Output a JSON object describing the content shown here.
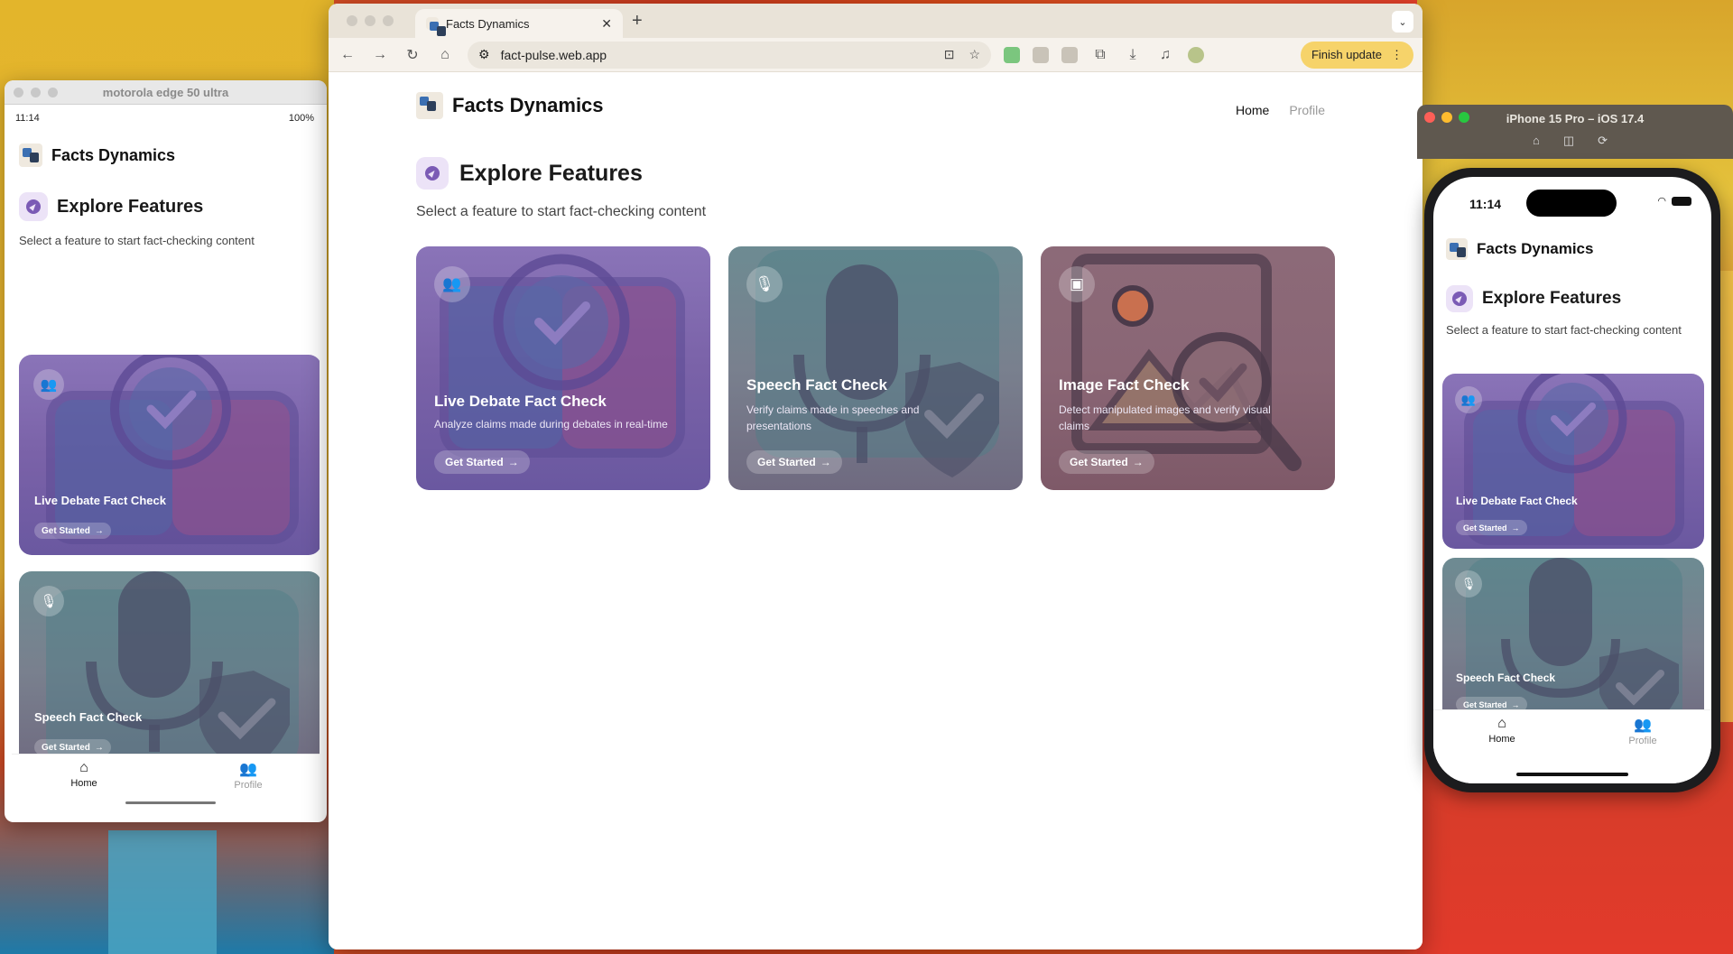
{
  "android": {
    "window_title": "motorola edge 50 ultra",
    "time": "11:14",
    "battery": "100%",
    "app_name": "Facts Dynamics",
    "section_title": "Explore Features",
    "section_subtitle": "Select a feature to start fact-checking content",
    "cards": [
      {
        "title": "Live Debate Fact Check",
        "button": "Get Started"
      },
      {
        "title": "Speech Fact Check",
        "button": "Get Started"
      }
    ],
    "nav": {
      "home": "Home",
      "profile": "Profile"
    }
  },
  "browser": {
    "tab_title": "Facts Dynamics",
    "url": "fact-pulse.web.app",
    "finish_update": "Finish update",
    "app_name": "Facts Dynamics",
    "nav": {
      "home": "Home",
      "profile": "Profile"
    },
    "section_title": "Explore Features",
    "section_subtitle": "Select a feature to start fact-checking content",
    "cards": [
      {
        "title": "Live Debate Fact Check",
        "description": "Analyze claims made during debates in real-time",
        "button": "Get Started",
        "icon": "people-icon"
      },
      {
        "title": "Speech Fact Check",
        "description": "Verify claims made in speeches and presentations",
        "button": "Get Started",
        "icon": "mic-icon"
      },
      {
        "title": "Image Fact Check",
        "description": "Detect manipulated images and verify visual claims",
        "button": "Get Started",
        "icon": "image-search-icon"
      }
    ]
  },
  "iphone": {
    "window_title": "iPhone 15 Pro – iOS 17.4",
    "time": "11:14",
    "app_name": "Facts Dynamics",
    "section_title": "Explore Features",
    "section_subtitle": "Select a feature to start fact-checking content",
    "cards": [
      {
        "title": "Live Debate Fact Check",
        "button": "Get Started"
      },
      {
        "title": "Speech Fact Check",
        "button": "Get Started"
      }
    ],
    "nav": {
      "home": "Home",
      "profile": "Profile"
    }
  },
  "colors": {
    "accent_purple": "#7b5bb5",
    "card_purple": "#7a62a8",
    "card_grey": "#79808e",
    "card_rose": "#8a6675",
    "update_yellow": "#f6d36a"
  }
}
